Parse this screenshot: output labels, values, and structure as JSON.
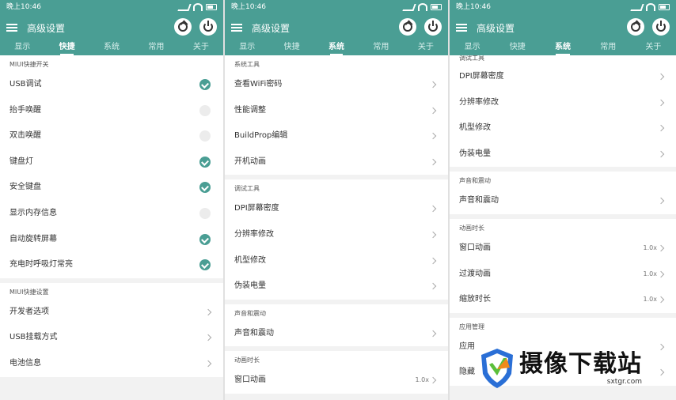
{
  "status": {
    "time": "晚上10:46"
  },
  "toolbar": {
    "title": "高级设置"
  },
  "tabs": [
    "显示",
    "快捷",
    "系统",
    "常用",
    "关于"
  ],
  "screens": [
    {
      "active_tab": 1,
      "sections": [
        {
          "title": "MIUI快捷开关",
          "items": [
            {
              "label": "USB调试",
              "check": true
            },
            {
              "label": "抬手唤醒",
              "check": false
            },
            {
              "label": "双击唤醒",
              "check": false
            },
            {
              "label": "键盘灯",
              "check": true
            },
            {
              "label": "安全键盘",
              "check": true
            },
            {
              "label": "显示内存信息",
              "check": false
            },
            {
              "label": "自动旋转屏幕",
              "check": true
            },
            {
              "label": "充电时呼吸灯常亮",
              "check": true
            }
          ]
        },
        {
          "title": "MIUI快捷设置",
          "items": [
            {
              "label": "开发者选项"
            },
            {
              "label": "USB挂载方式"
            },
            {
              "label": "电池信息"
            }
          ]
        }
      ]
    },
    {
      "active_tab": 2,
      "sections": [
        {
          "title": "系统工具",
          "items": [
            {
              "label": "查看WiFi密码"
            },
            {
              "label": "性能调整"
            },
            {
              "label": "BuildProp编辑"
            },
            {
              "label": "开机动画"
            }
          ]
        },
        {
          "title": "调试工具",
          "items": [
            {
              "label": "DPI屏幕密度"
            },
            {
              "label": "分辨率修改"
            },
            {
              "label": "机型修改"
            },
            {
              "label": "伪装电量"
            }
          ]
        },
        {
          "title": "声音和震动",
          "items": [
            {
              "label": "声音和震动"
            }
          ]
        },
        {
          "title": "动画时长",
          "items": [
            {
              "label": "窗口动画",
              "value": "1.0x"
            }
          ]
        }
      ]
    },
    {
      "active_tab": 2,
      "sections": [
        {
          "title": "调试工具",
          "items": [
            {
              "label": "DPI屏幕密度"
            },
            {
              "label": "分辨率修改"
            },
            {
              "label": "机型修改"
            },
            {
              "label": "伪装电量"
            }
          ]
        },
        {
          "title": "声音和震动",
          "items": [
            {
              "label": "声音和震动"
            }
          ]
        },
        {
          "title": "动画时长",
          "items": [
            {
              "label": "窗口动画",
              "value": "1.0x"
            },
            {
              "label": "过渡动画",
              "value": "1.0x"
            },
            {
              "label": "缩放时长",
              "value": "1.0x"
            }
          ]
        },
        {
          "title": "应用管理",
          "items": [
            {
              "label": "应用"
            },
            {
              "label": "隐藏"
            }
          ]
        }
      ]
    }
  ],
  "watermark": {
    "title": "摄像下载站",
    "url": "sxtgr.com",
    "colors": {
      "blue": "#2a6fd6",
      "green": "#5bbf3a",
      "orange": "#f08a1c"
    }
  },
  "colors": {
    "primary": "#4a9e94",
    "background": "#f2f2f2"
  }
}
